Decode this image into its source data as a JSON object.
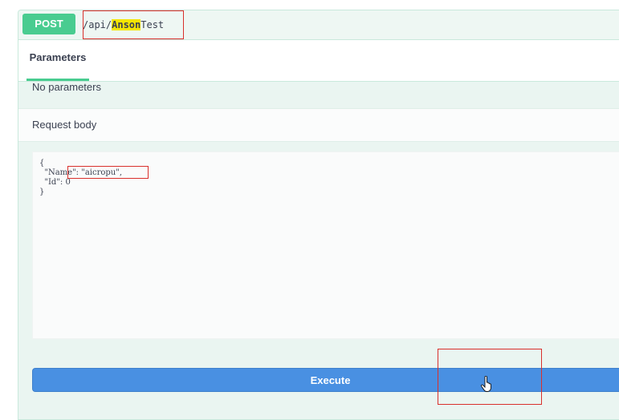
{
  "operation": {
    "method": "POST",
    "path_prefix": "/api/",
    "path_highlight": "Anson",
    "path_suffix": "Test"
  },
  "tabs": [
    {
      "label": "Parameters",
      "active": true
    }
  ],
  "parameters": {
    "empty_text": "No parameters"
  },
  "request_body": {
    "label": "Request body",
    "code": "{\n  \"Name\": \"aicropu\",\n  \"Id\": 0\n}"
  },
  "actions": {
    "execute_label": "Execute"
  },
  "colors": {
    "method_post": "#49cc90",
    "execute": "#4990e2",
    "highlight": "#f4e500",
    "annotation": "#d9302c"
  },
  "icons": {
    "cursor": "hand-pointer-icon"
  }
}
